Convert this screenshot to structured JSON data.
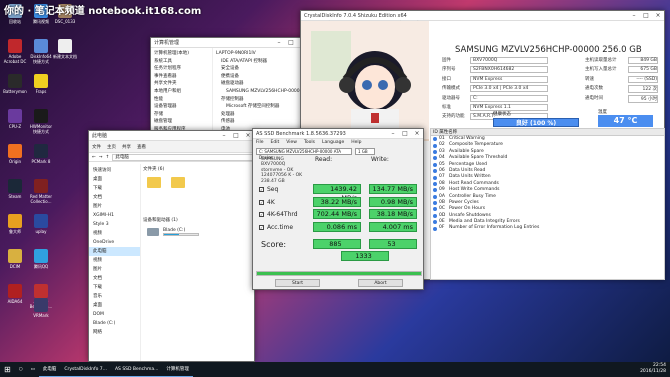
{
  "watermark": "你的 · 笔记本频道 notebook.it168.com",
  "desktop_icons": [
    {
      "label": "回收站",
      "color": "#7aa0c8"
    },
    {
      "label": "Adobe Acrobat DC",
      "color": "#c0282c"
    },
    {
      "label": "Batterymon",
      "color": "#2a2a2a"
    },
    {
      "label": "CPU-Z",
      "color": "#6a3a9e"
    },
    {
      "label": "Origin",
      "color": "#f07020"
    },
    {
      "label": "Steam",
      "color": "#1b2838"
    },
    {
      "label": "鲁大师",
      "color": "#e8a020"
    },
    {
      "label": "DCIM",
      "color": "#d8b040"
    },
    {
      "label": "AIDA64",
      "color": "#b02020"
    },
    {
      "label": "腾讯视频",
      "color": "#3a8ae0"
    },
    {
      "label": "DiskInfo64 快捷方式",
      "color": "#5a8ad8"
    },
    {
      "label": "Fraps",
      "color": "#f0d020"
    },
    {
      "label": "HWMonitor 快捷方式",
      "color": "#1a1a1a"
    },
    {
      "label": "PCMark 8",
      "color": "#202840"
    },
    {
      "label": "Red Matter Collectio...",
      "color": "#802020"
    },
    {
      "label": "uplay",
      "color": "#2a4aa0"
    },
    {
      "label": "腾讯QQ",
      "color": "#30a0e0"
    },
    {
      "label": "AS SSD Benchma...",
      "color": "#c03030"
    },
    {
      "label": "DSC_0133",
      "color": "#a08060"
    },
    {
      "label": "新建文本文档",
      "color": "#eeeeee"
    },
    {
      "label": "VRMark",
      "color": "#3a3a6a"
    }
  ],
  "explorer": {
    "title": "计算机管理",
    "ribbon": [
      "文件",
      "主页",
      "共享",
      "查看"
    ],
    "address": "此电脑",
    "nav": [
      "快速访问",
      "桌面",
      "下载",
      "文档",
      "图片",
      "XGIMI-H1",
      "Style 3",
      "视频",
      "OneDrive",
      "此电脑",
      "视频",
      "图片",
      "文档",
      "下载",
      "音乐",
      "桌面",
      "DOM",
      "Blade (C:)",
      "网络"
    ],
    "sections": [
      "文件夹 (6)",
      "设备和驱动器 (1)"
    ],
    "drive": "Blade (C:)"
  },
  "devmgr": {
    "tree": [
      "LAPTOP-9N0RI1IV",
      "IDE ATA/ATAPI 控制器",
      "安全设备",
      "便携设备",
      "磁盘驱动器",
      "SAMSUNG MZVLV256HCHP-00000",
      "存储控制器",
      "Microsoft 存储空间控制器",
      "处理器",
      "传感器",
      "电池",
      "固件",
      "计算机",
      "监视器",
      "键盘"
    ],
    "left": [
      "计算机管理(本地)",
      "系统工具",
      "任务计划程序",
      "事件查看器",
      "共享文件夹",
      "本地用户和组",
      "性能",
      "设备管理器",
      "存储",
      "磁盘管理",
      "服务和应用程序"
    ]
  },
  "cdi": {
    "title": "CrystalDiskInfo 7.0.4 Shizuku Edition x64",
    "menu": [
      "文件(F)",
      "编辑(E)",
      "功能(U)",
      "主题(T)",
      "磁盘(D)",
      "帮助(H)",
      "语言(Language)"
    ],
    "disk_title": "SAMSUNG MZVLV256HCHP-00000 256.0 GB",
    "rows": [
      {
        "label": "固件",
        "value": "BXV7000Q",
        "extra_label": "主机读取量总计",
        "extra": "849 GB"
      },
      {
        "label": "序列号",
        "value": "S2FBNX0H614682",
        "extra_label": "主机写入量总计",
        "extra": "675 GB"
      },
      {
        "label": "接口",
        "value": "NVM Express",
        "extra_label": "转速",
        "extra": "---- (SSD)"
      },
      {
        "label": "传输模式",
        "value": "PCIe 3.0 x4 | PCIe 3.0 x4",
        "extra_label": "通电次数",
        "extra": "122 次"
      },
      {
        "label": "驱动器号",
        "value": "C:",
        "extra_label": "通电时间",
        "extra": "95 小时"
      },
      {
        "label": "标准",
        "value": "NVM Express 1.1",
        "extra_label": "",
        "extra": ""
      },
      {
        "label": "支持的功能",
        "value": "S.M.A.R.T.",
        "extra_label": "",
        "extra": ""
      }
    ],
    "health_label": "健康状态",
    "health": "良好 (100 %)",
    "temp_label": "温度",
    "temp": "47 °C",
    "attr_header": "ID 属性名称",
    "attrs": [
      {
        "id": "01",
        "name": "Critical Warning"
      },
      {
        "id": "02",
        "name": "Composite Temperature"
      },
      {
        "id": "03",
        "name": "Available Spare"
      },
      {
        "id": "04",
        "name": "Available Spare Threshold"
      },
      {
        "id": "05",
        "name": "Percentage Used"
      },
      {
        "id": "06",
        "name": "Data Units Read"
      },
      {
        "id": "07",
        "name": "Data Units Written"
      },
      {
        "id": "08",
        "name": "Host Read Commands"
      },
      {
        "id": "09",
        "name": "Host Write Commands"
      },
      {
        "id": "0A",
        "name": "Controller Busy Time"
      },
      {
        "id": "0B",
        "name": "Power Cycles"
      },
      {
        "id": "0C",
        "name": "Power On Hours"
      },
      {
        "id": "0D",
        "name": "Unsafe Shutdowns"
      },
      {
        "id": "0E",
        "name": "Media and Data Integrity Errors"
      },
      {
        "id": "0F",
        "name": "Number of Error Information Log Entries"
      }
    ]
  },
  "asssd": {
    "title": "AS SSD Benchmark 1.8.5636.37293",
    "menu": [
      "File",
      "Edit",
      "View",
      "Tools",
      "Language",
      "Help"
    ],
    "drive_select": "C: SAMSUNG MZVLV256HCHP-00000 ATA Device",
    "size_select": "1 GB",
    "info": [
      "SAMSUNG",
      "BXV7000Q",
      "stornvme - OK",
      "124077056 K - OK",
      "238.47 GB"
    ],
    "read_h": "Read:",
    "write_h": "Write:",
    "tests": [
      {
        "label": "Seq",
        "read": "1439.42 MB/s",
        "write": "134.77 MB/s"
      },
      {
        "label": "4K",
        "read": "38.22 MB/s",
        "write": "0.98 MB/s"
      },
      {
        "label": "4K-64Thrd",
        "read": "702.44 MB/s",
        "write": "38.18 MB/s"
      },
      {
        "label": "Acc.time",
        "read": "0.086 ms",
        "write": "4.007 ms"
      }
    ],
    "score_label": "Score:",
    "score_read": "885",
    "score_write": "53",
    "score_total": "1333",
    "start": "Start",
    "abort": "Abort"
  },
  "taskbar": {
    "items": [
      "此电脑",
      "CrystalDiskInfo 7...",
      "AS SSD Benchma...",
      "计算机管理"
    ],
    "time": "22:54",
    "date": "2016/11/28"
  }
}
